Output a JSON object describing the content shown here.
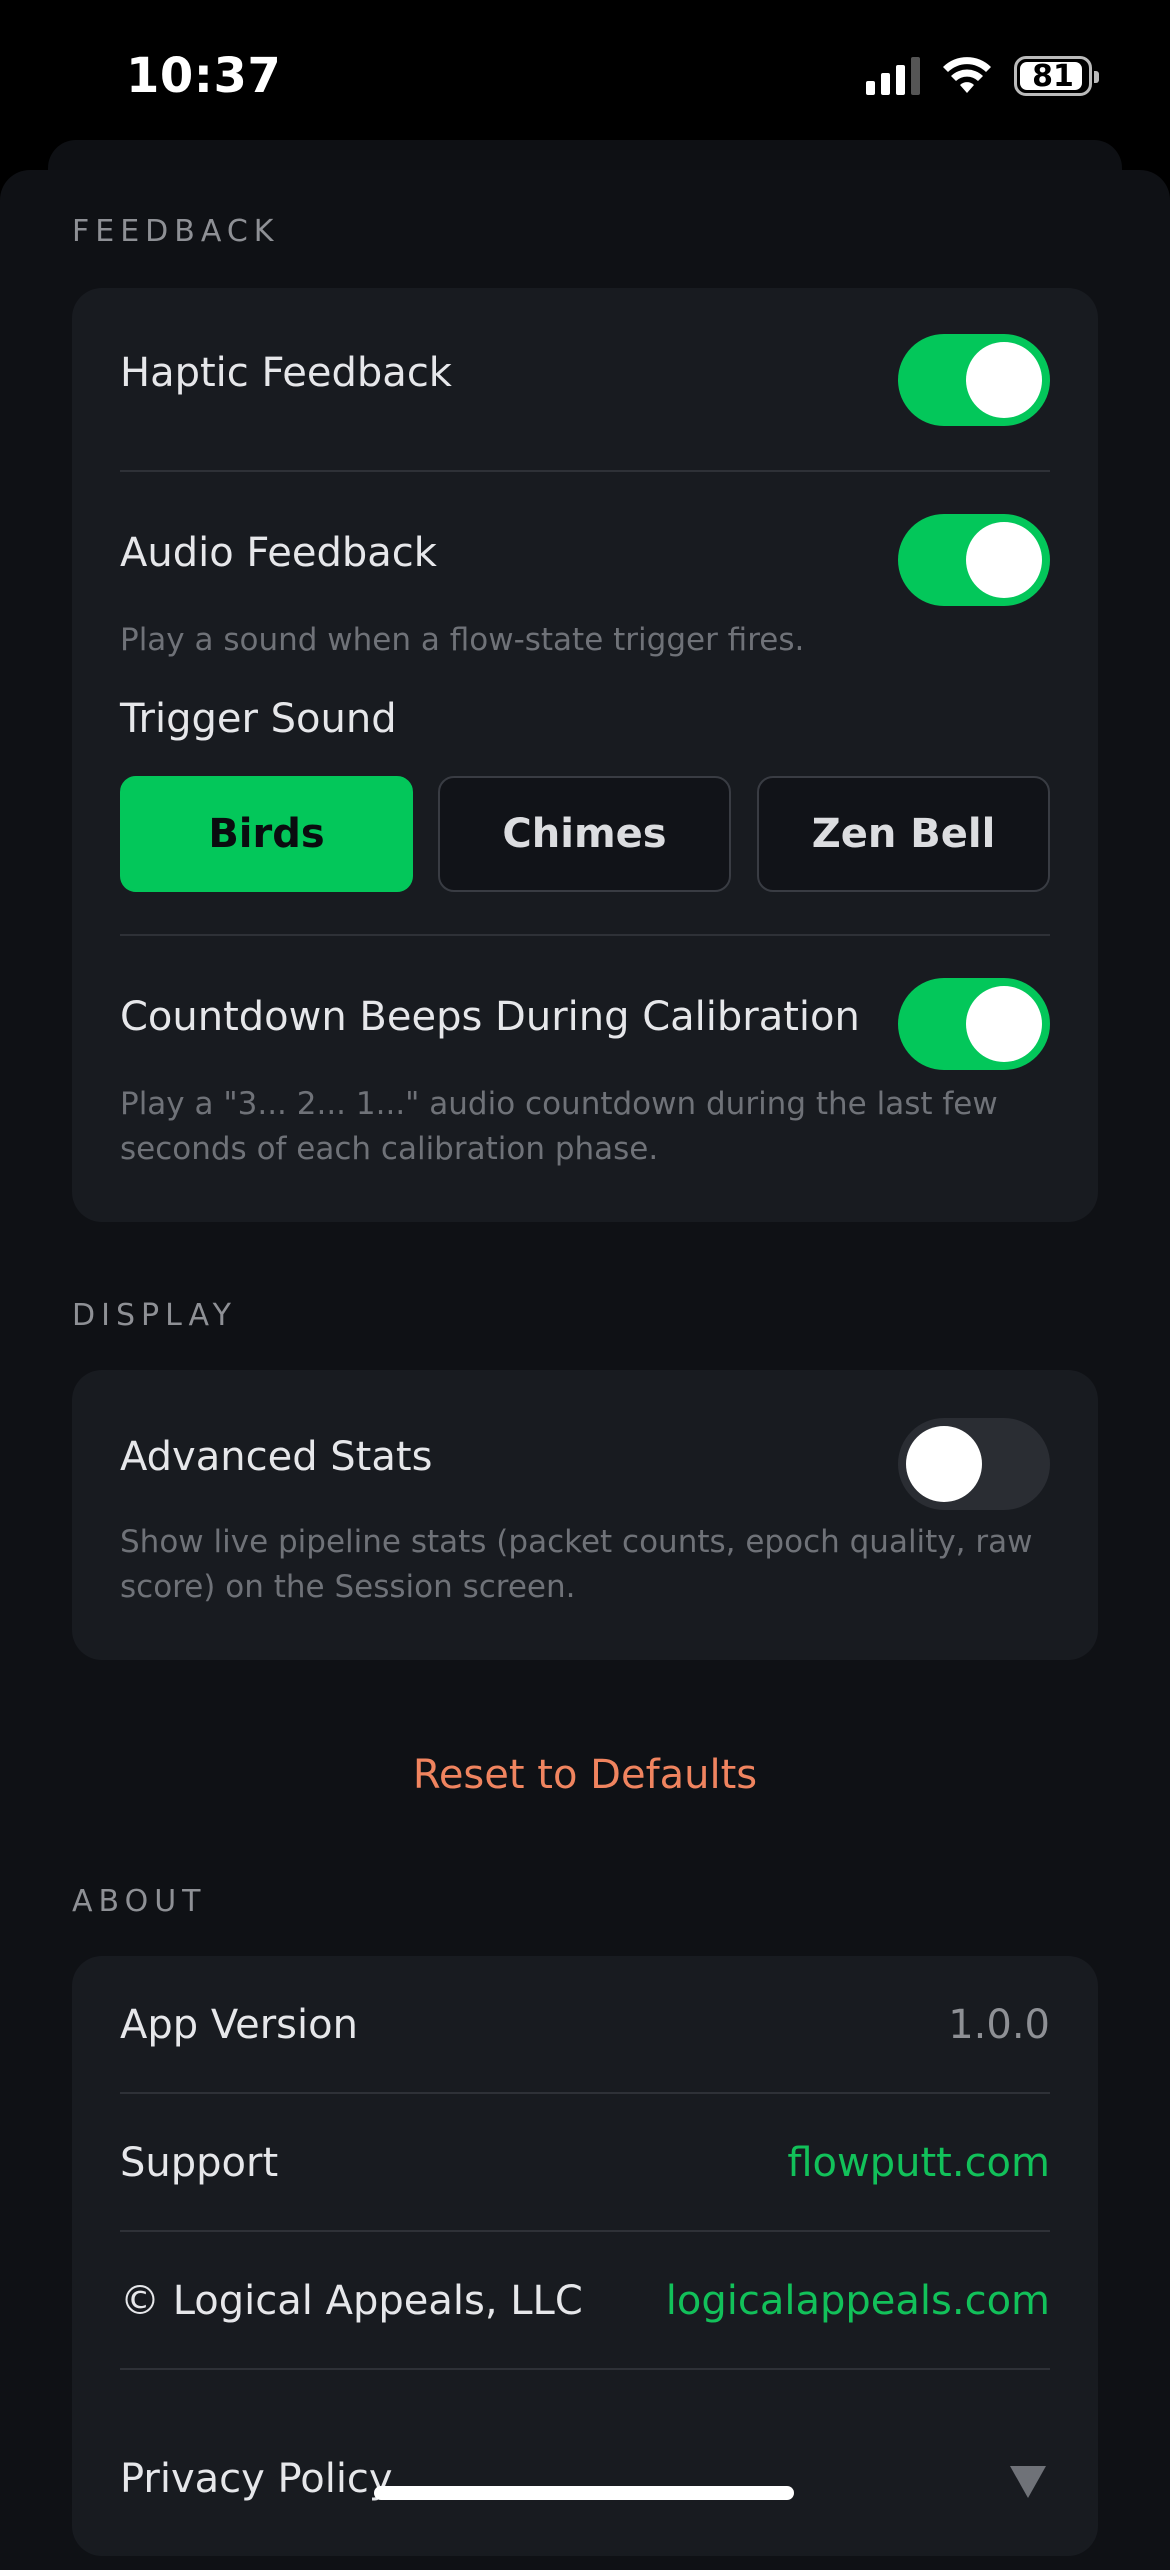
{
  "status": {
    "time": "10:37",
    "battery": "81"
  },
  "feedback": {
    "header": "FEEDBACK",
    "haptic": {
      "label": "Haptic Feedback",
      "on": true
    },
    "audio": {
      "label": "Audio Feedback",
      "description": "Play a sound when a flow-state trigger fires.",
      "on": true
    },
    "trigger_sound": {
      "label": "Trigger Sound",
      "options": [
        "Birds",
        "Chimes",
        "Zen Bell"
      ],
      "selected": "Birds"
    },
    "countdown": {
      "label": "Countdown Beeps During Calibration",
      "description": "Play a \"3... 2... 1...\" audio countdown during the last few seconds of each calibration phase.",
      "on": true
    }
  },
  "display": {
    "header": "DISPLAY",
    "advanced_stats": {
      "label": "Advanced Stats",
      "description": "Show live pipeline stats (packet counts, epoch quality, raw score) on the Session screen.",
      "on": false
    }
  },
  "reset_label": "Reset to Defaults",
  "about": {
    "header": "ABOUT",
    "version": {
      "label": "App Version",
      "value": "1.0.0"
    },
    "support": {
      "label": "Support",
      "link": "flowputt.com"
    },
    "company": {
      "label": "© Logical Appeals, LLC",
      "link": "logicalappeals.com"
    },
    "privacy": {
      "label": "Privacy Policy"
    }
  },
  "colors": {
    "accent": "#03c75a",
    "destructive": "#f0845f",
    "link": "#12c15a"
  }
}
